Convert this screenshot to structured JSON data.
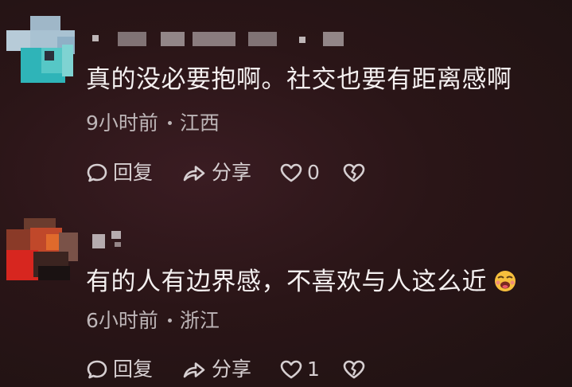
{
  "comments": [
    {
      "text": "真的没必要抱啊。社交也要有距离感啊",
      "time": "9小时前",
      "location": "江西",
      "reply_label": "回复",
      "share_label": "分享",
      "like_count": "0"
    },
    {
      "text": "有的人有边界感，不喜欢与人这么近",
      "time": "6小时前",
      "location": "浙江",
      "reply_label": "回复",
      "share_label": "分享",
      "like_count": "1",
      "emoji": "laughing-face-emoji"
    }
  ],
  "icons": {
    "reply": "speech-bubble-icon",
    "share": "share-arrow-icon",
    "like": "heart-icon",
    "dislike": "broken-heart-icon"
  },
  "colors": {
    "background": "#2a1517",
    "text": "#f4f0f0",
    "meta": "#bdb5b7"
  }
}
